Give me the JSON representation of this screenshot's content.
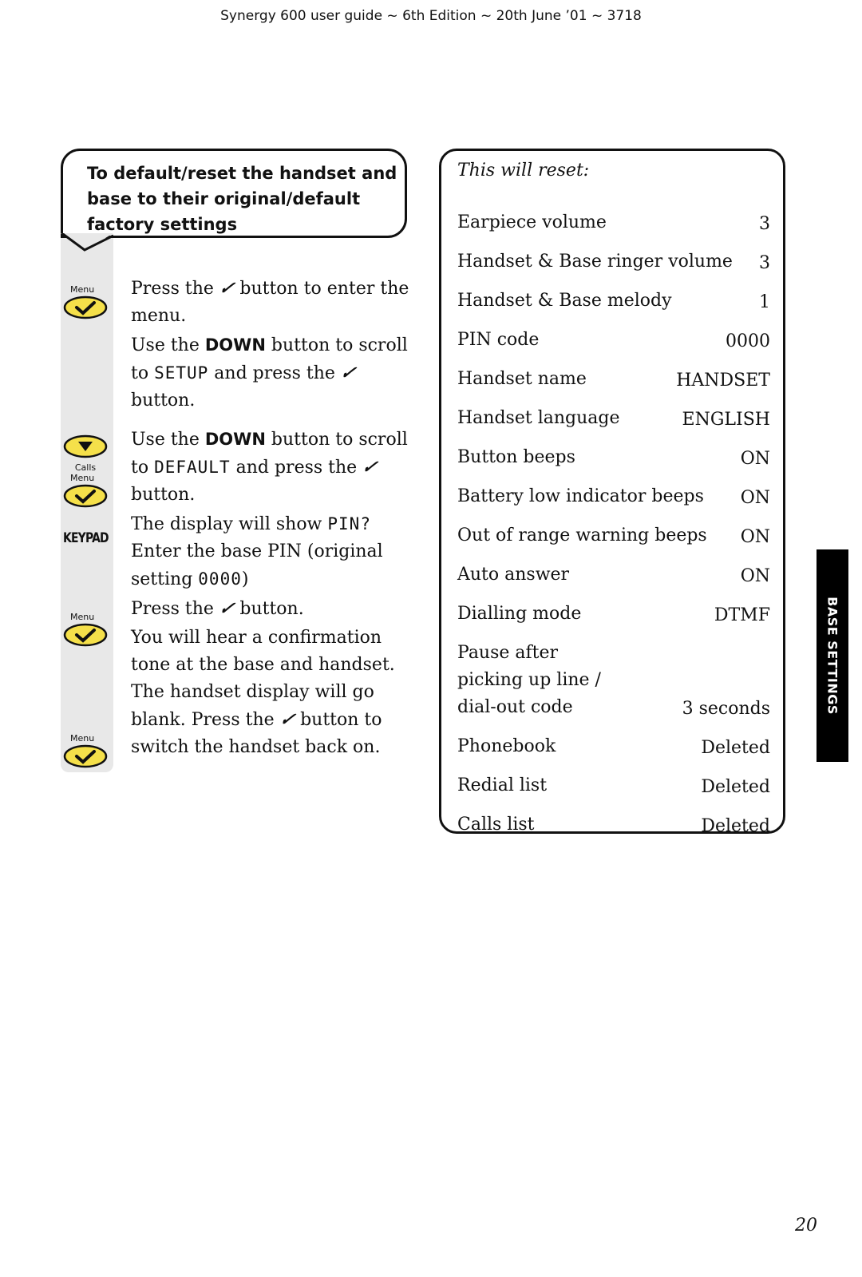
{
  "header": {
    "text": "Synergy 600 user guide ~ 6th Edition ~ 20th June ’01 ~ 3718"
  },
  "title": {
    "line1": "To default/reset the handset and",
    "line2": "base to their original/default",
    "line3": "factory settings"
  },
  "keys": {
    "menu_label": "Menu",
    "calls_label": "Calls",
    "keypad_label": "KEYPAD",
    "check_icon": "✔",
    "down_icon": "▼"
  },
  "steps": [
    {
      "a": "Press the ",
      "b": " button to enter the menu."
    },
    {
      "a": "Use the ",
      "bold": "DOWN",
      "b": " button to scroll to ",
      "lcd": "SETUP",
      "c": " and press the ",
      "d": " button."
    },
    {
      "a": "Use the ",
      "bold": "DOWN",
      "b": " button to scroll to ",
      "lcd": "DEFAULT",
      "c": " and press the ",
      "d": " button."
    },
    {
      "a": "The display will show ",
      "lcd": "PIN?",
      "b": " Enter the base PIN (original setting ",
      "lcd2": "0000",
      "c": ")"
    },
    {
      "a": "Press the ",
      "b": " button."
    },
    {
      "a": "You will hear a confirmation tone at the base and handset. The handset display will go blank. Press the ",
      "b": " button to switch the handset back on."
    }
  ],
  "reset": {
    "title": "This will reset:",
    "rows": [
      {
        "label": "Earpiece volume",
        "value": "3"
      },
      {
        "label": "Handset & Base ringer volume",
        "value": "3"
      },
      {
        "label": "Handset & Base melody",
        "value": "1"
      },
      {
        "label": "PIN code",
        "value": "0000"
      },
      {
        "label": "Handset name",
        "value": "HANDSET"
      },
      {
        "label": "Handset language",
        "value": "ENGLISH"
      },
      {
        "label": "Button beeps",
        "value": "ON"
      },
      {
        "label": "Battery low indicator beeps",
        "value": "ON"
      },
      {
        "label": "Out of range warning beeps",
        "value": "ON"
      },
      {
        "label": "Auto answer",
        "value": "ON"
      },
      {
        "label": "Dialling mode",
        "value": "DTMF"
      },
      {
        "label": "Pause after\npicking up line /\ndial-out code",
        "value": "3 seconds"
      },
      {
        "label": "Phonebook",
        "value": "Deleted"
      },
      {
        "label": "Redial list",
        "value": "Deleted"
      },
      {
        "label": "Calls list",
        "value": "Deleted"
      }
    ]
  },
  "side_tab": {
    "text": "BASE SETTINGS"
  },
  "page_number": "20"
}
